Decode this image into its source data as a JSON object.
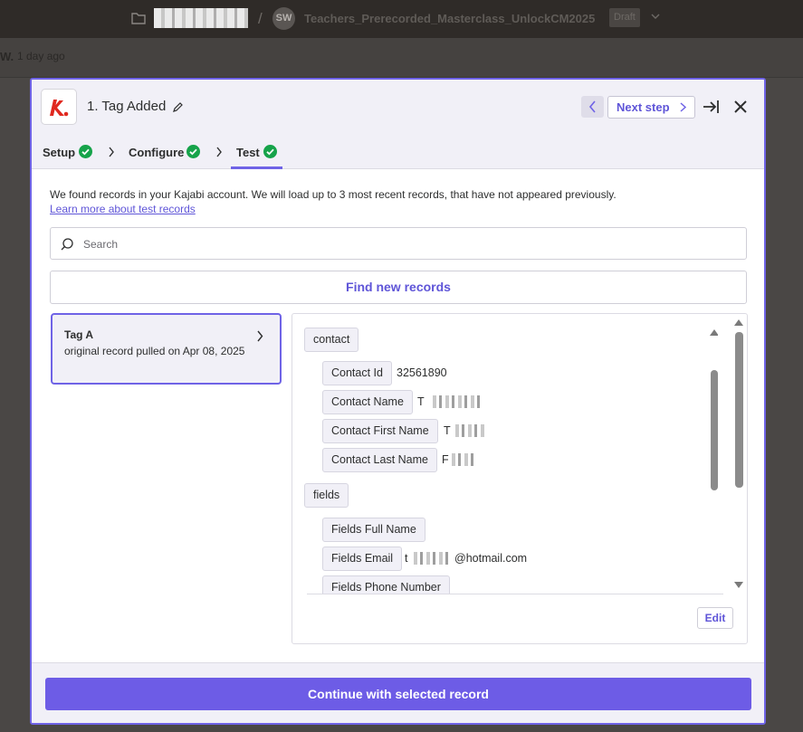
{
  "topbar": {
    "avatar_initials": "SW",
    "zap_title": "Teachers_Prerecorded_Masterclass_UnlockCM2025",
    "status_badge": "Draft"
  },
  "subbar": {
    "user": "W.",
    "time": "1 day ago"
  },
  "modal": {
    "step_title": "1. Tag Added",
    "next_step_label": "Next step",
    "tabs": [
      {
        "label": "Setup",
        "complete": true
      },
      {
        "label": "Configure",
        "complete": true
      },
      {
        "label": "Test",
        "complete": true
      }
    ],
    "info_text": "We found records in your Kajabi account. We will load up to 3 most recent records, that have not appeared previously.",
    "learn_more_link": "Learn more about test records",
    "search_placeholder": "Search",
    "find_button_label": "Find new records",
    "record": {
      "title": "Tag A",
      "subtitle": "original record pulled on Apr 08, 2025"
    },
    "data": {
      "group_contact": "contact",
      "contact_id_label": "Contact Id",
      "contact_id_value": "32561890",
      "contact_name_label": "Contact Name",
      "contact_name_value": "T",
      "contact_first_name_label": "Contact First Name",
      "contact_first_name_value": "T",
      "contact_last_name_label": "Contact Last Name",
      "contact_last_name_value": "F",
      "group_fields": "fields",
      "fields_full_name_label": "Fields Full Name",
      "fields_email_label": "Fields Email",
      "fields_email_prefix": "t",
      "fields_email_domain": "@hotmail.com",
      "fields_phone_label": "Fields Phone Number"
    },
    "edit_label": "Edit",
    "continue_label": "Continue with selected record"
  },
  "colors": {
    "accent": "#6f63e6",
    "success": "#16a34a",
    "app_brand": "#e0281f"
  },
  "icons": [
    "folder-icon",
    "kajabi-logo-icon",
    "pencil-icon",
    "chevron-left-icon",
    "chevron-right-icon",
    "expand-panel-icon",
    "close-icon",
    "check-circle-icon",
    "search-icon"
  ]
}
